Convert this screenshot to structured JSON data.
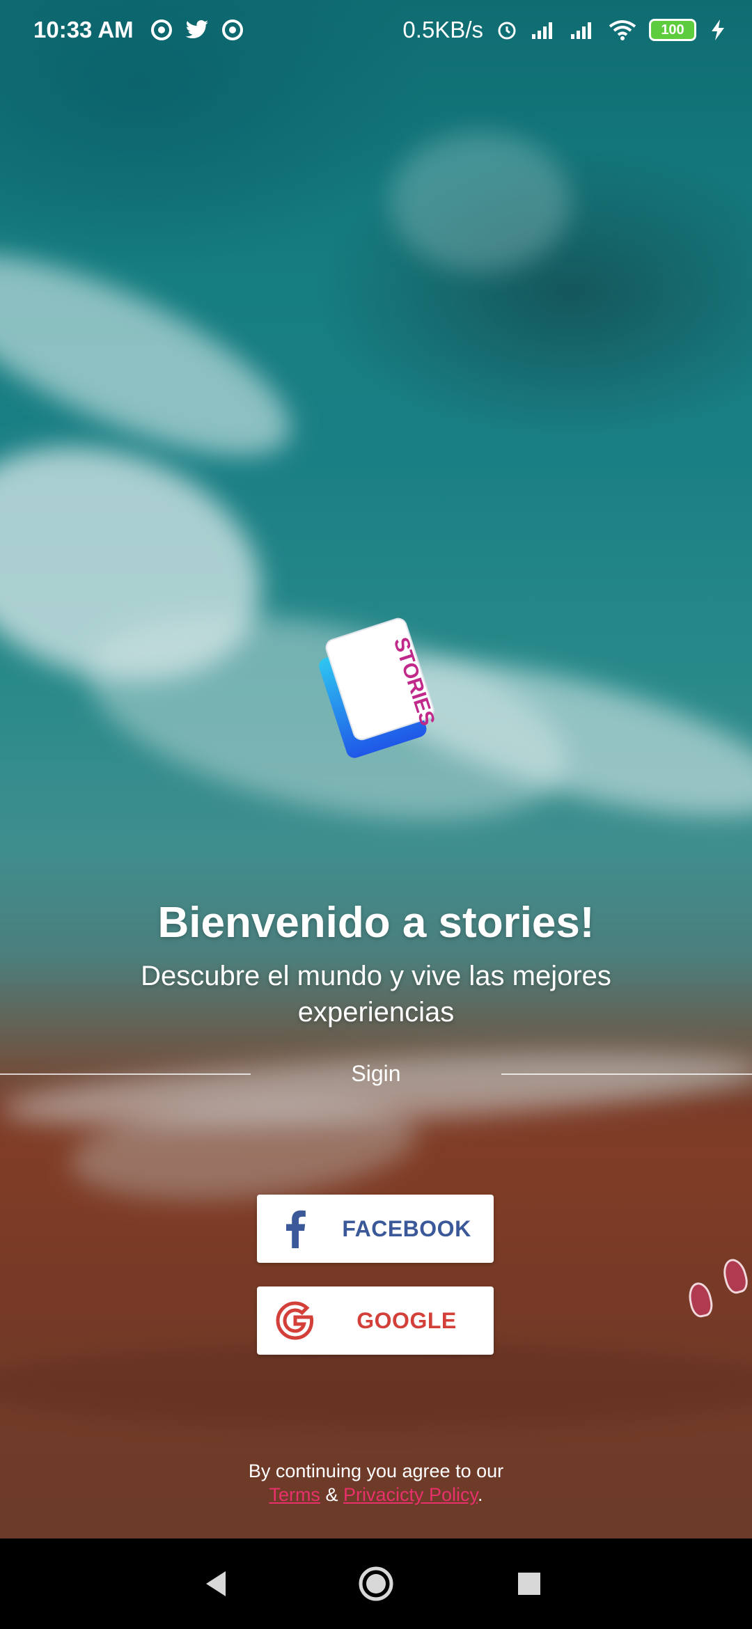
{
  "status_bar": {
    "time": "10:33 AM",
    "network_speed": "0.5KB/s",
    "battery": "100",
    "left_icons": [
      "sync-icon",
      "twitter-icon",
      "sync-icon"
    ],
    "right_icons": [
      "alarm-icon",
      "signal-icon",
      "signal-icon",
      "wifi-icon",
      "battery-icon",
      "charging-icon"
    ]
  },
  "logo": {
    "text": "STORIES"
  },
  "welcome": {
    "title": "Bienvenido a stories!",
    "subtitle": "Descubre el mundo y vive las mejores experiencias"
  },
  "signin": {
    "label": "Sigin"
  },
  "buttons": {
    "facebook": {
      "label": "FACEBOOK",
      "icon": "facebook-icon",
      "color": "#3b5998"
    },
    "google": {
      "label": "GOOGLE",
      "icon": "google-icon",
      "color": "#d3403a"
    }
  },
  "terms": {
    "prefix": "By continuing you agree to our",
    "terms_link": "Terms",
    "and": "&",
    "privacy_link": "Privacicty Policy",
    "suffix": ".",
    "link_color": "#e8306b"
  },
  "navbar": {
    "icons": [
      "back-icon",
      "home-icon",
      "recent-apps-icon"
    ]
  }
}
